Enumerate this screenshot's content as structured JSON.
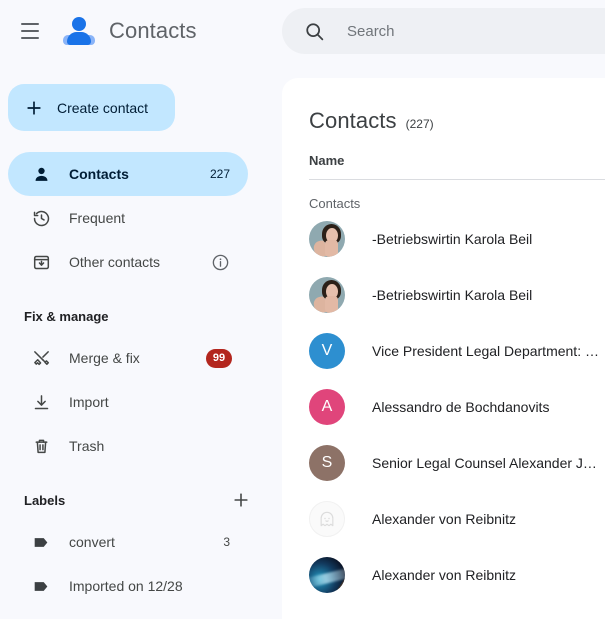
{
  "app": {
    "title": "Contacts",
    "logo_icon": "contacts-logo-icon",
    "menu_icon": "hamburger-menu-icon"
  },
  "search": {
    "placeholder": "Search",
    "value": "",
    "icon": "search-icon"
  },
  "sidebar": {
    "create_button": {
      "label": "Create contact",
      "icon": "plus-icon"
    },
    "nav": [
      {
        "label": "Contacts",
        "icon": "person-icon",
        "count": "227",
        "active": true
      },
      {
        "label": "Frequent",
        "icon": "history-icon",
        "count": "",
        "active": false
      },
      {
        "label": "Other contacts",
        "icon": "archive-down-icon",
        "count": "",
        "active": false,
        "trailing_icon": "info-icon"
      }
    ],
    "fix_section": {
      "title": "Fix & manage",
      "items": [
        {
          "label": "Merge & fix",
          "icon": "merge-tools-icon",
          "badge": "99"
        },
        {
          "label": "Import",
          "icon": "download-icon",
          "badge": ""
        },
        {
          "label": "Trash",
          "icon": "trash-icon",
          "badge": ""
        }
      ]
    },
    "labels_section": {
      "title": "Labels",
      "add_icon": "plus-icon",
      "items": [
        {
          "label": "convert",
          "icon": "label-tag-icon",
          "count": "3"
        },
        {
          "label": "Imported on 12/28",
          "icon": "label-tag-icon",
          "count": ""
        }
      ]
    }
  },
  "main": {
    "title": "Contacts",
    "count": "(227)",
    "column_header": "Name",
    "group_label": "Contacts",
    "rows": [
      {
        "name": "-Betriebswirtin Karola Beil",
        "avatar_type": "photo-portrait",
        "initial": "",
        "color": "#8fa9b0"
      },
      {
        "name": "-Betriebswirtin Karola Beil",
        "avatar_type": "photo-portrait",
        "initial": "",
        "color": "#8fa9b0"
      },
      {
        "name": "Vice President Legal Department: …",
        "avatar_type": "initial",
        "initial": "V",
        "color": "#2d8fd0"
      },
      {
        "name": "Alessandro de Bochdanovits",
        "avatar_type": "initial",
        "initial": "A",
        "color": "#e0457b"
      },
      {
        "name": "Senior Legal Counsel Alexander Ju…",
        "avatar_type": "initial",
        "initial": "S",
        "color": "#8d7267"
      },
      {
        "name": "Alexander von Reibnitz",
        "avatar_type": "ghost",
        "initial": "",
        "color": "#fafafa"
      },
      {
        "name": "Alexander von Reibnitz",
        "avatar_type": "photo-galaxy",
        "initial": "",
        "color": "#123a5e"
      }
    ]
  },
  "colors": {
    "accent_blue": "#1a73e8",
    "active_pill": "#c2e7ff",
    "badge_red": "#b3261e",
    "sidebar_bg": "#f8f9fd",
    "card_bg": "#ffffff"
  }
}
